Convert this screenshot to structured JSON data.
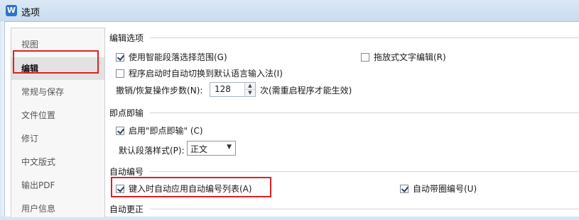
{
  "window": {
    "title": "选项",
    "icon": "wps-logo-icon"
  },
  "sidebar": {
    "items": [
      {
        "label": "视图"
      },
      {
        "label": "编辑"
      },
      {
        "label": "常规与保存"
      },
      {
        "label": "文件位置"
      },
      {
        "label": "修订"
      },
      {
        "label": "中文版式"
      },
      {
        "label": "输出PDF"
      },
      {
        "label": "用户信息"
      }
    ],
    "selected": "编辑"
  },
  "sections": {
    "edit_options": {
      "title": "编辑选项",
      "smart_paragraph": {
        "label": "使用智能段落选择范围(G)",
        "checked": true
      },
      "drag_text": {
        "label": "拖放式文字编辑(R)",
        "checked": false
      },
      "auto_ime": {
        "label": "程序启动时自动切换到默认语言输入法(I)",
        "checked": false
      },
      "undo_steps": {
        "label": "撤销/恢复操作步数(N):",
        "value": "128",
        "suffix": "次(需重启程序才能生效)"
      }
    },
    "click_and_type": {
      "title": "即点即输",
      "enable": {
        "label": "启用\"即点即输\" (C)",
        "checked": true
      },
      "default_style": {
        "label": "默认段落样式(P):",
        "value": "正文"
      }
    },
    "auto_numbering": {
      "title": "自动编号",
      "auto_list": {
        "label": "键入时自动应用自动编号列表(A)",
        "checked": true
      },
      "circled_numbers": {
        "label": "自动带圈编号(U)",
        "checked": true
      }
    },
    "auto_correct": {
      "title": "自动更正"
    }
  },
  "colors": {
    "highlight": "#e02020",
    "selected_bg": "#e2e2e2",
    "title_bar": "#dbe8f6"
  }
}
